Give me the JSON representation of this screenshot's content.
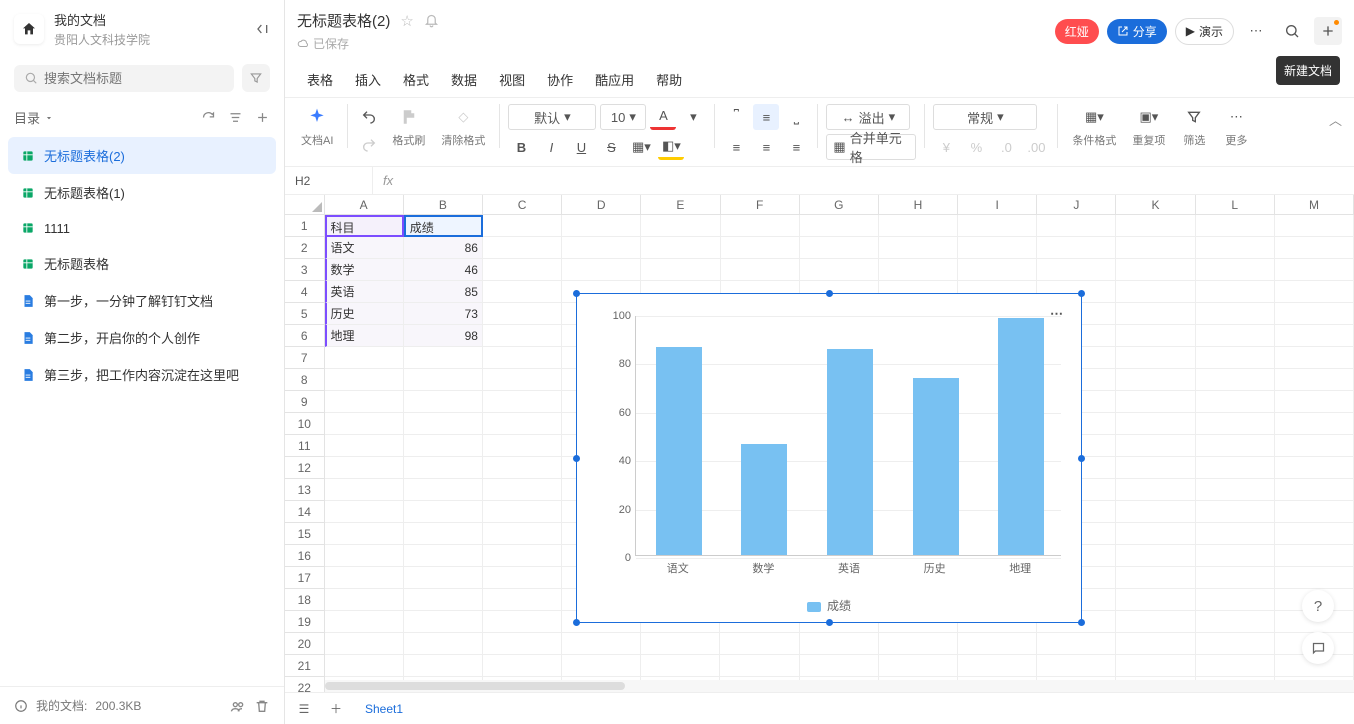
{
  "sidebar": {
    "title": "我的文档",
    "subtitle": "贵阳人文科技学院",
    "search_placeholder": "搜索文档标题",
    "catalog_label": "目录",
    "items": [
      {
        "label": "无标题表格(2)",
        "type": "sheet",
        "active": true
      },
      {
        "label": "无标题表格(1)",
        "type": "sheet"
      },
      {
        "label": "1111",
        "type": "sheet"
      },
      {
        "label": "无标题表格",
        "type": "sheet"
      },
      {
        "label": "第一步，一分钟了解钉钉文档",
        "type": "doc"
      },
      {
        "label": "第二步，开启你的个人创作",
        "type": "doc"
      },
      {
        "label": "第三步，把工作内容沉淀在这里吧",
        "type": "doc"
      }
    ],
    "footer": {
      "storage_label": "我的文档:",
      "storage_value": "200.3KB"
    }
  },
  "header": {
    "doc_title": "无标题表格(2)",
    "saved_label": "已保存",
    "badge_red": "红娅",
    "share_label": "分享",
    "present_label": "演示",
    "tooltip_new": "新建文档"
  },
  "menu": [
    "表格",
    "插入",
    "格式",
    "数据",
    "视图",
    "协作",
    "酷应用",
    "帮助"
  ],
  "toolbar": {
    "ai": "文档AI",
    "fmtpaint": "格式刷",
    "clrfmt": "清除格式",
    "font_name": "默认",
    "font_size": "10",
    "wrap": "溢出",
    "numfmt": "常规",
    "merge": "合并单元格",
    "condfmt": "条件格式",
    "dup": "重复项",
    "filter": "筛选",
    "more": "更多"
  },
  "formula": {
    "cell_ref": "H2"
  },
  "sheet": {
    "columns": [
      "A",
      "B",
      "C",
      "D",
      "E",
      "F",
      "G",
      "H",
      "I",
      "J",
      "K",
      "L",
      "M"
    ],
    "header_row": {
      "A": "科目",
      "B": "成绩"
    },
    "rows": [
      {
        "A": "语文",
        "B": 86
      },
      {
        "A": "数学",
        "B": 46
      },
      {
        "A": "英语",
        "B": 85
      },
      {
        "A": "历史",
        "B": 73
      },
      {
        "A": "地理",
        "B": 98
      }
    ],
    "total_rows": 22,
    "tab": "Sheet1"
  },
  "chart_data": {
    "type": "bar",
    "categories": [
      "语文",
      "数学",
      "英语",
      "历史",
      "地理"
    ],
    "values": [
      86,
      46,
      85,
      73,
      98
    ],
    "series_name": "成绩",
    "ylim": [
      0,
      100
    ],
    "yticks": [
      0,
      20,
      40,
      60,
      80,
      100
    ]
  }
}
